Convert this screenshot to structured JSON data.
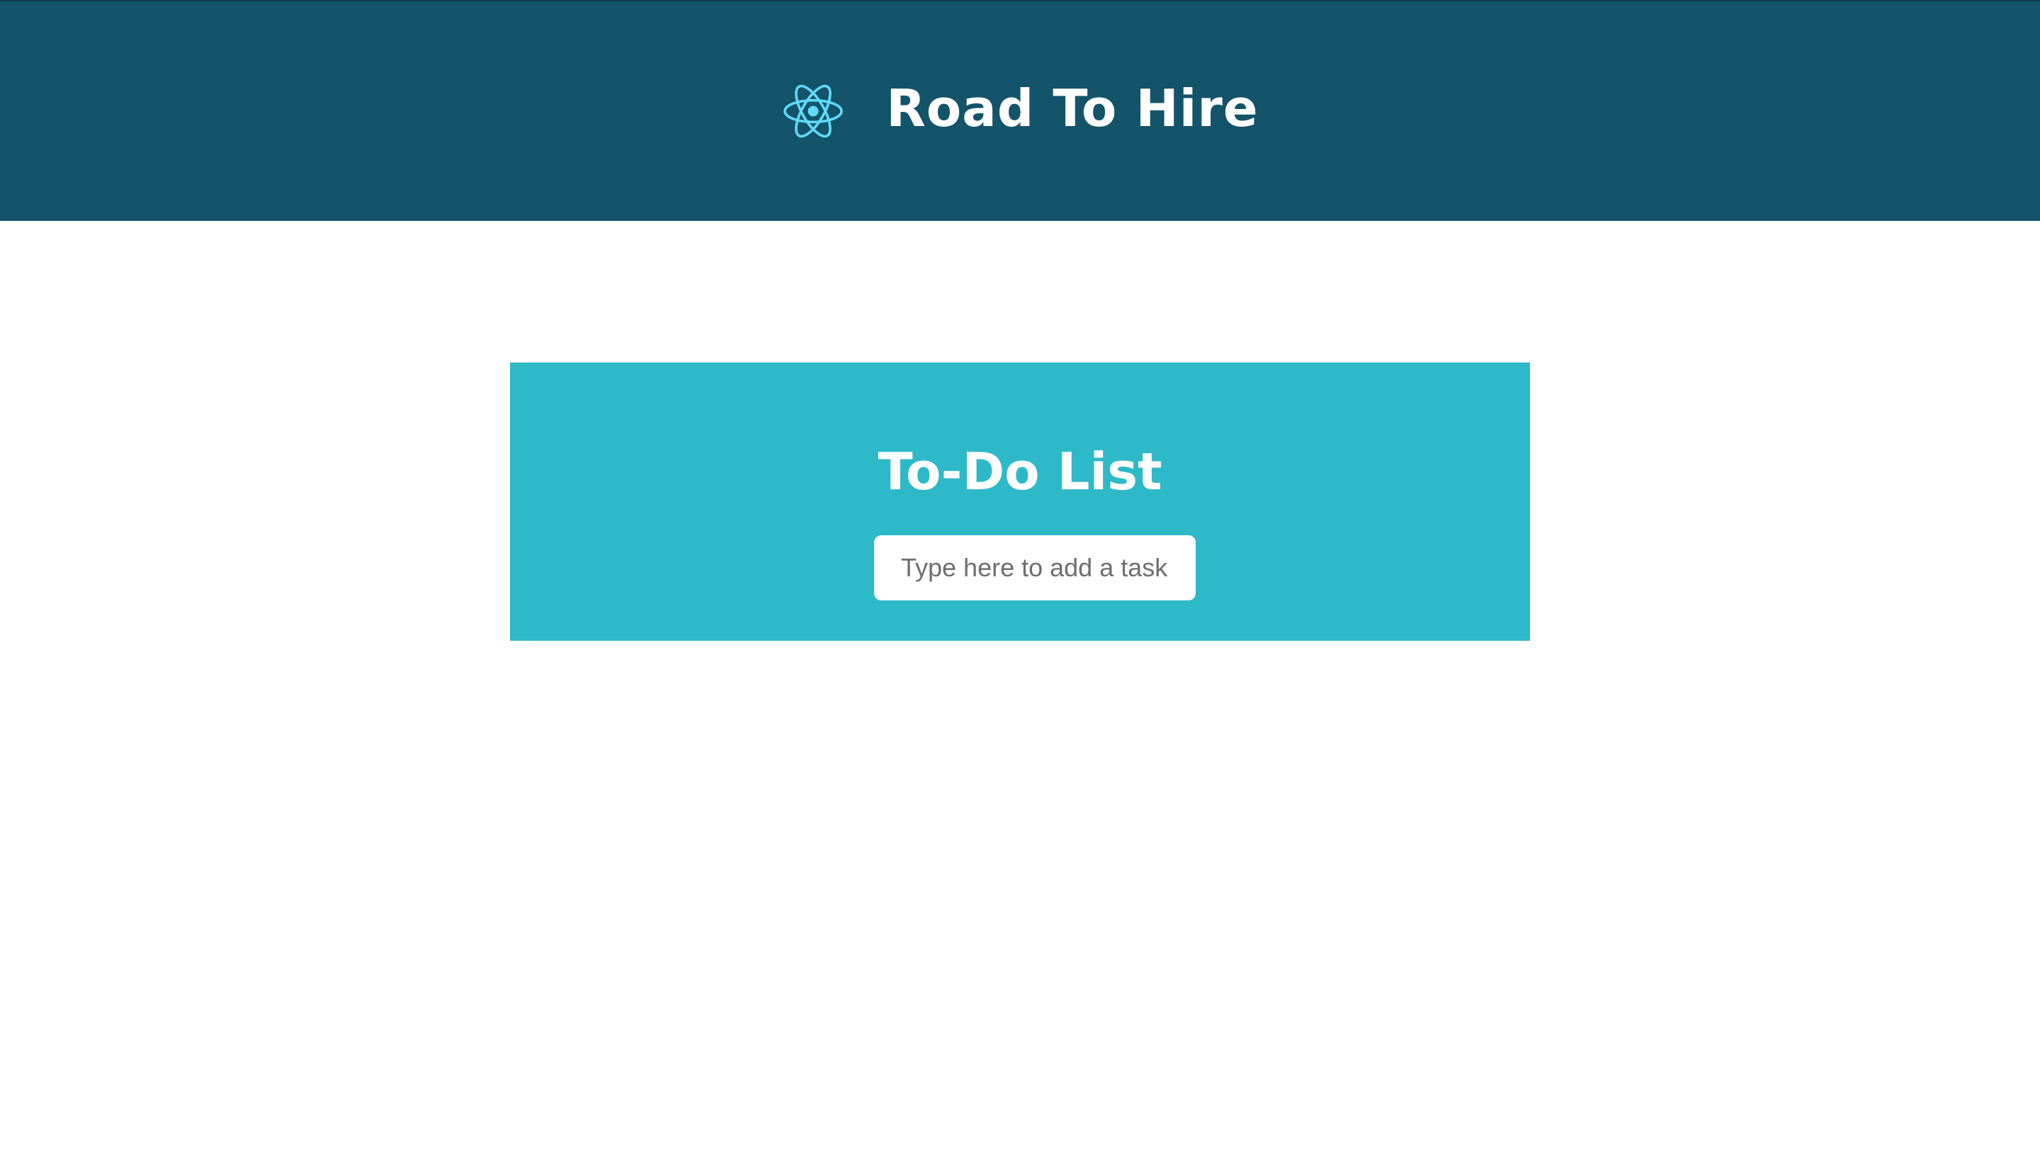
{
  "header": {
    "logo_icon": "react-atom-icon",
    "logo_color": "#61dafb",
    "title": "Road To Hire",
    "background": "#13546a"
  },
  "todo": {
    "title": "To-Do List",
    "background": "#2eb9c9",
    "input": {
      "value": "",
      "placeholder": "Type here to add a task"
    }
  }
}
